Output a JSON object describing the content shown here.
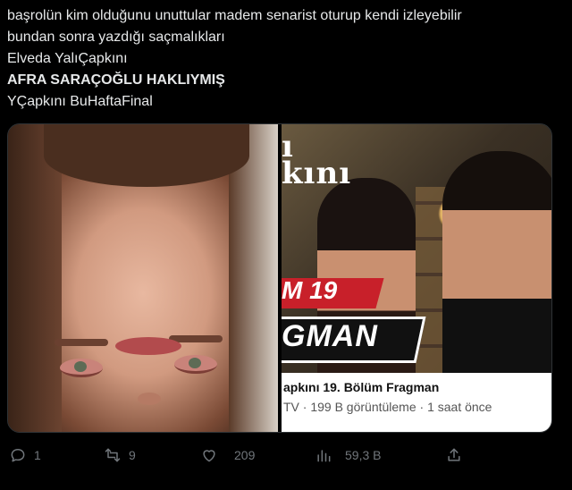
{
  "tweet": {
    "lines": [
      "başrolün kim olduğunu unuttular madem senarist oturup kendi izleyebilir",
      "bundan sonra yazdığı saçmalıkları",
      "Elveda YalıÇapkını",
      "AFRA SARAÇOĞLU HAKLIYMIŞ",
      "YÇapkını BuHaftaFinal"
    ]
  },
  "media": {
    "right_logo_lines": [
      "ı",
      "kını"
    ],
    "episode_overlay": "M 19",
    "fragman_overlay": "GMAN",
    "caption_title": "apkını 19. Bölüm Fragman",
    "caption_meta": "TV · 199 B görüntüleme · 1 saat önce"
  },
  "actions": {
    "reply_count": "1",
    "retweet_count": "9",
    "like_count": "209",
    "views_count": "59,3 B",
    "icons": [
      "reply-icon",
      "retweet-icon",
      "like-icon",
      "views-icon",
      "share-icon"
    ]
  },
  "colors": {
    "background": "#000000",
    "text": "#e7e9ea",
    "muted": "#71767b",
    "episode_badge": "#c8202a"
  }
}
